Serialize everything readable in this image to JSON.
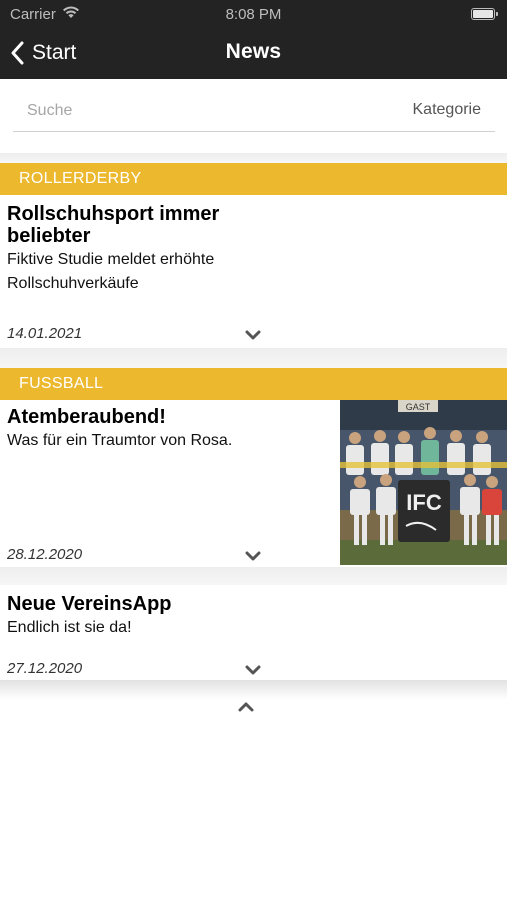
{
  "status_bar": {
    "carrier": "Carrier",
    "time": "8:08 PM"
  },
  "nav": {
    "back_label": "Start",
    "title": "News"
  },
  "search": {
    "placeholder": "Suche",
    "category_label": "Kategorie"
  },
  "articles": [
    {
      "category": "ROLLERDERBY",
      "title": "Rollschuhsport immer beliebter",
      "teaser": "Fiktive Studie meldet erhöhte Rollschuhverkäufe",
      "date": "14.01.2021"
    },
    {
      "category": "FUSSBALL",
      "title": "Atemberaubend!",
      "teaser": "Was für ein Traumtor von Rosa.",
      "date": "28.12.2020",
      "image": {
        "banner_text": "IFC",
        "sign_text": "GAST"
      }
    },
    {
      "title": "Neue VereinsApp",
      "teaser": "Endlich ist sie da!",
      "date": "27.12.2020"
    }
  ],
  "colors": {
    "topbar": "#232323",
    "accent": "#ecb82e",
    "divider": "#d2d2d2"
  },
  "icons": {
    "back": "chevron-left-icon",
    "expand": "chevron-down-icon",
    "collapse": "chevron-up-icon",
    "wifi": "wifi-icon",
    "battery": "battery-icon"
  }
}
